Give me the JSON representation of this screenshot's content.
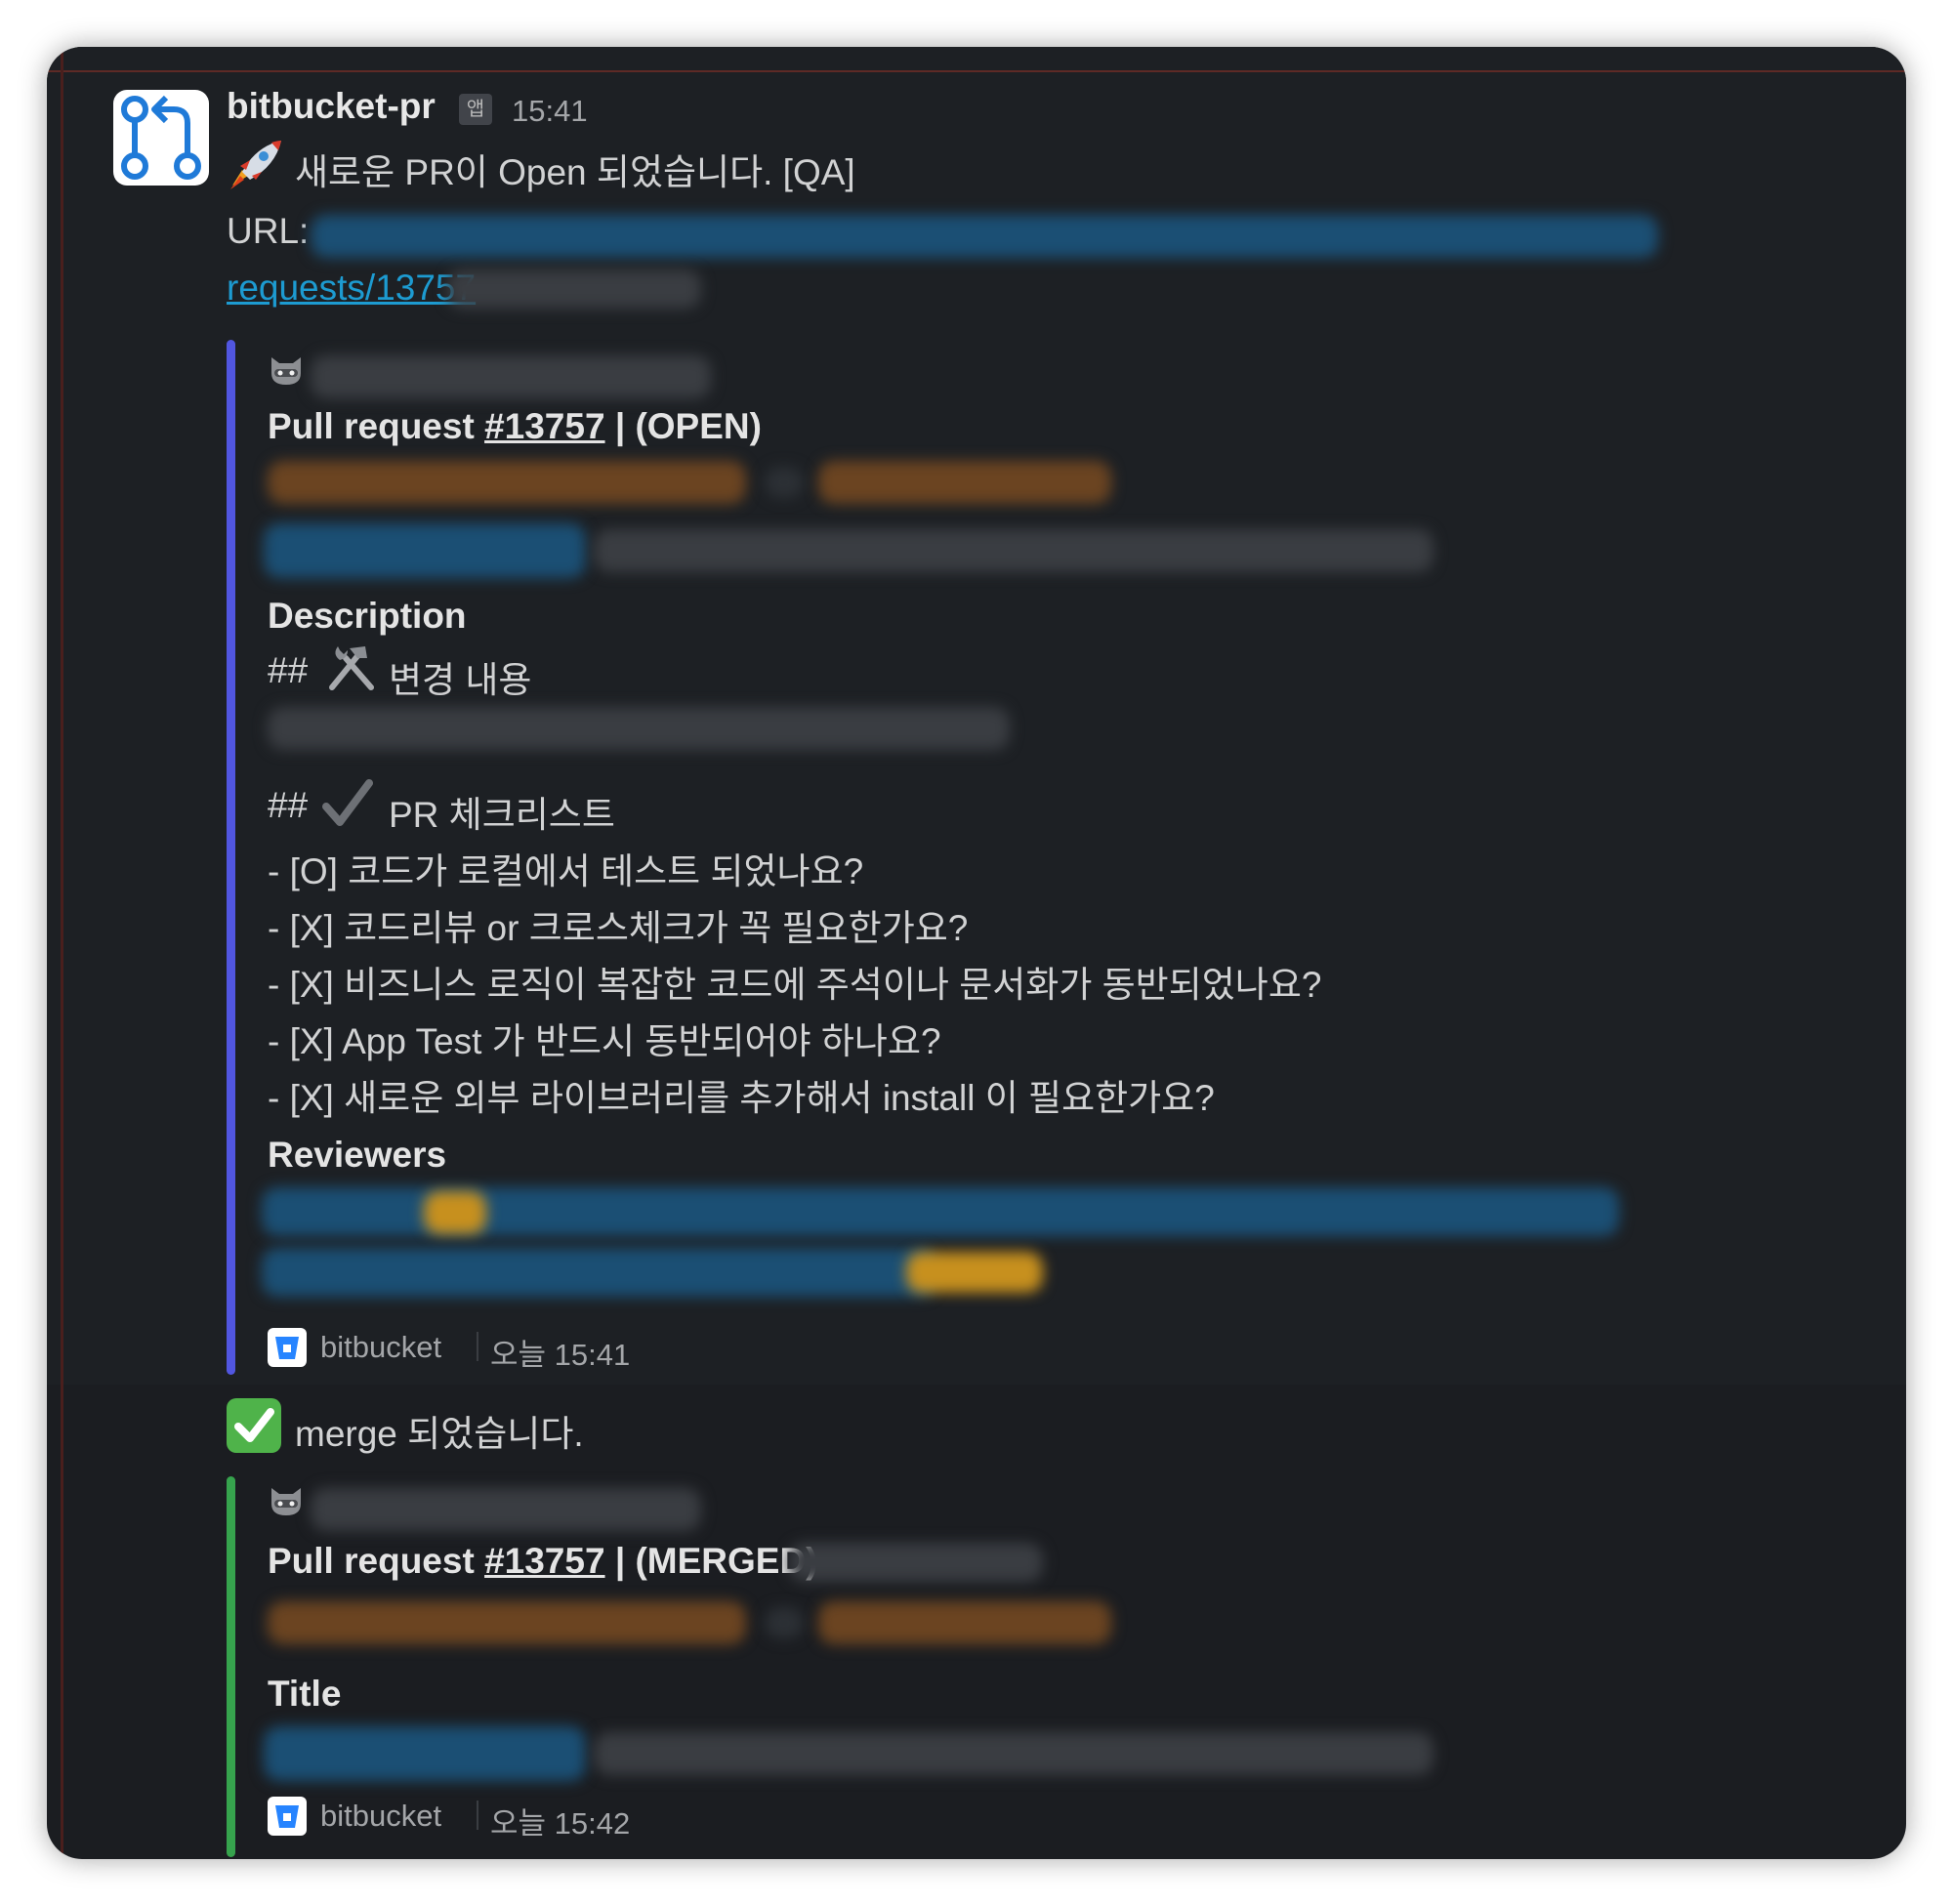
{
  "message1": {
    "sender": "bitbucket-pr",
    "app_badge": "앱",
    "time": "15:41",
    "headline": "새로운 PR이 Open 되었습니다. [QA]",
    "url_label": "URL:",
    "url_link_text": "requests/13757"
  },
  "card1": {
    "pr_prefix": "Pull request",
    "pr_number": "#13757",
    "pr_status": "| (OPEN)",
    "description_heading": "Description",
    "changes_heading": "## ",
    "changes_text": "변경 내용",
    "checklist_heading": "## ",
    "checklist_text": "PR 체크리스트",
    "checklist": [
      "- [O]  코드가 로컬에서 테스트 되었나요?",
      "- [X]  코드리뷰 or 크로스체크가 꼭 필요한가요?",
      "- [X]  비즈니스 로직이 복잡한 코드에 주석이나 문서화가 동반되었나요?",
      "- [X]  App Test 가 반드시 동반되어야 하나요?",
      "- [X]  새로운 외부 라이브러리를 추가해서 install 이 필요한가요?"
    ],
    "reviewers_heading": "Reviewers",
    "footer_app": "bitbucket",
    "footer_time": "오늘 15:41"
  },
  "message2": {
    "headline": "merge 되었습니다."
  },
  "card2": {
    "pr_prefix": "Pull request",
    "pr_number": "#13757",
    "pr_status": "| (MERGED)",
    "title_heading": "Title",
    "footer_app": "bitbucket",
    "footer_time": "오늘 15:42"
  },
  "colors": {
    "background": "#1b1d21",
    "link": "#1d9bd1",
    "open_rail": "#5156e0",
    "merged_rail": "#36a34d"
  }
}
